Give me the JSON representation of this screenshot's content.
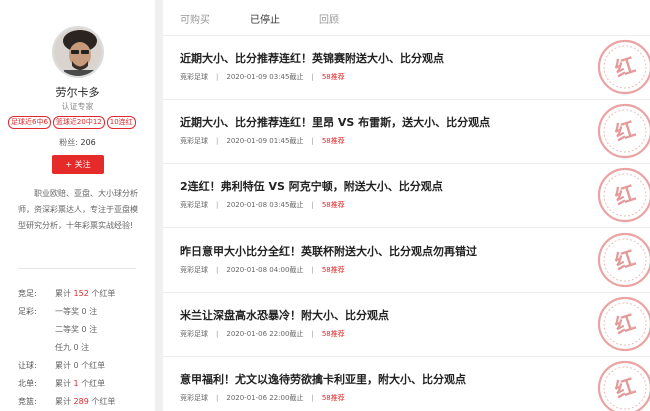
{
  "profile": {
    "name": "劳尔卡多",
    "title": "认证专家",
    "badges": [
      "足球近6中6",
      "篮球近20中12",
      "10连红"
    ],
    "fans_label": "粉丝:",
    "fans_count": "206",
    "follow_label": "+ 关注",
    "intro": "职业欧赔、亚盘、大小球分析师，资深彩票达人，专注于亚盘模型研究分析，十年彩票实战经验!",
    "stats": [
      {
        "key": "竞足:",
        "pre": "累计",
        "num": "152",
        "post": "个红单",
        "red": true
      },
      {
        "key": "足彩:",
        "pre": "",
        "num": "",
        "post": "一等奖 0 注",
        "red": false
      },
      {
        "key": "",
        "pre": "",
        "num": "",
        "post": "二等奖 0 注",
        "red": false
      },
      {
        "key": "",
        "pre": "",
        "num": "",
        "post": "任九 0 注",
        "red": false
      },
      {
        "key": "让球:",
        "pre": "累计",
        "num": "0",
        "post": "个红单",
        "red": false
      },
      {
        "key": "北单:",
        "pre": "累计",
        "num": "1",
        "post": "个红单",
        "red": true
      },
      {
        "key": "竞篮:",
        "pre": "累计",
        "num": "289",
        "post": "个红单",
        "red": true
      }
    ]
  },
  "tabs": [
    "可购买",
    "已停止",
    "回顾"
  ],
  "active_tab": "已停止",
  "articles": [
    {
      "title": "近期大小、比分推荐连红！英锦赛附送大小、比分观点",
      "category": "竞彩足球",
      "time": "2020-01-09 03:45截止",
      "price": "58推荐"
    },
    {
      "title": "近期大小、比分推荐连红！里昂 VS 布雷斯，送大小、比分观点",
      "category": "竞彩足球",
      "time": "2020-01-09 01:45截止",
      "price": "58推荐"
    },
    {
      "title": "2连红！弗利特伍 VS 阿克宁顿，附送大小、比分观点",
      "category": "竞彩足球",
      "time": "2020-01-08 03:45截止",
      "price": "58推荐"
    },
    {
      "title": "昨日意甲大小比分全红！英联杯附送大小、比分观点勿再错过",
      "category": "竞彩足球",
      "time": "2020-01-08 04:00截止",
      "price": "58推荐"
    },
    {
      "title": "米兰让深盘高水恐暴冷！附大小、比分观点",
      "category": "竞彩足球",
      "time": "2020-01-06 22:00截止",
      "price": "58推荐"
    },
    {
      "title": "意甲福利！尤文以逸待劳欲擒卡利亚里，附大小、比分观点",
      "category": "竞彩足球",
      "time": "2020-01-06 22:00截止",
      "price": "58推荐"
    }
  ],
  "stamp_text": "红",
  "colors": {
    "accent": "#e0292d",
    "follow_bg": "#e52a2a"
  },
  "icons": {
    "avatar": "user-avatar-photo",
    "stamp": "red-win-stamp"
  }
}
